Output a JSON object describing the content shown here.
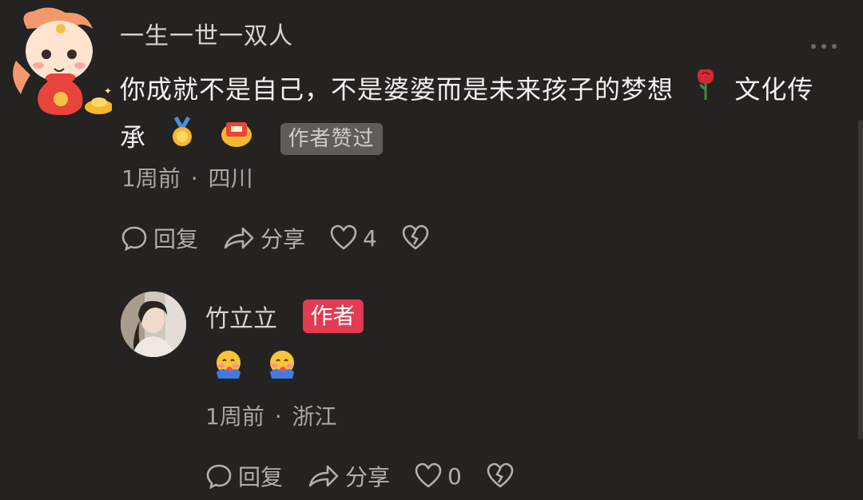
{
  "comment": {
    "username": "一生一世一双人",
    "text_line1": "你成就不是自己，不是婆婆而是未来孩子的梦想",
    "text_line1_tail": "文化传",
    "text_line2": "承",
    "author_liked_badge": "作者赞过",
    "time": "1周前",
    "location": "四川",
    "reply_label": "回复",
    "share_label": "分享",
    "like_count": "4"
  },
  "reply": {
    "username": "竹立立",
    "author_badge": "作者",
    "time": "1周前",
    "location": "浙江",
    "reply_label": "回复",
    "share_label": "分享",
    "like_count": "0"
  },
  "separator": "·",
  "icons": {
    "avatar": "cartoon-horse-avatar-icon",
    "more": "more-dots-icon",
    "rose": "rose-emoji-icon",
    "medal": "medal-emoji-icon",
    "gift": "gift-emoji-icon",
    "hug": "hug-emoji-icon",
    "reply": "chat-bubble-icon",
    "share": "share-arrow-icon",
    "like": "heart-icon",
    "dislike": "broken-heart-icon"
  },
  "colors": {
    "background": "#252222",
    "author_badge": "#e23b52",
    "liked_badge": "#5f5c5c"
  }
}
